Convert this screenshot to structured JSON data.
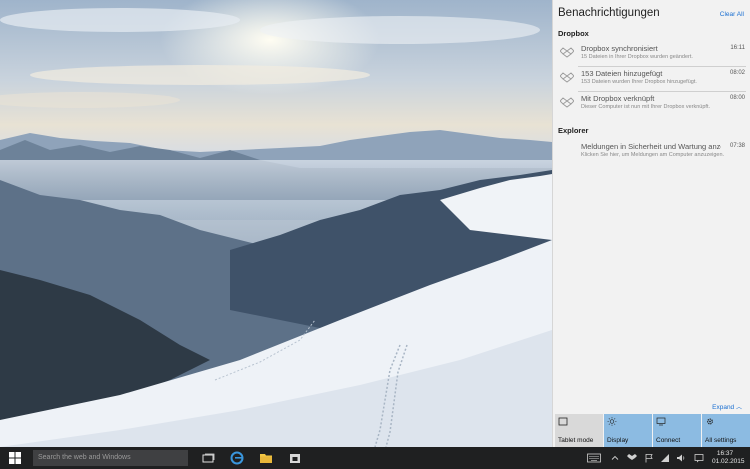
{
  "action_center": {
    "title": "Benachrichtigungen",
    "clear_all": "Clear All",
    "expand": "Expand",
    "groups": [
      {
        "name": "Dropbox",
        "notifications": [
          {
            "title": "Dropbox synchronisiert",
            "body": "15 Dateien in Ihrer Dropbox wurden geändert.",
            "time": "16:11"
          },
          {
            "title": "153 Dateien hinzugefügt",
            "body": "153 Dateien wurden Ihrer Dropbox hinzugefügt.",
            "time": "08:02"
          },
          {
            "title": "Mit Dropbox verknüpft",
            "body": "Dieser Computer ist nun mit Ihrer Dropbox verknüpft.",
            "time": "08:00"
          }
        ]
      },
      {
        "name": "Explorer",
        "notifications": [
          {
            "title": "Meldungen in Sicherheit und Wartung anzeigen",
            "body": "Klicken Sie hier, um Meldungen am Computer anzuzeigen.",
            "time": "07:38"
          }
        ]
      }
    ],
    "quick_actions": [
      {
        "label": "Tablet mode",
        "icon": "tablet-icon",
        "state": "off"
      },
      {
        "label": "Display",
        "icon": "brightness-icon",
        "state": "on"
      },
      {
        "label": "Connect",
        "icon": "connect-icon",
        "state": "on"
      },
      {
        "label": "All settings",
        "icon": "gear-icon",
        "state": "on"
      }
    ]
  },
  "taskbar": {
    "search_placeholder": "Search the web and Windows",
    "clock_time": "16:37",
    "clock_date": "01.02.2015",
    "pinned": [
      {
        "icon": "task-view-icon"
      },
      {
        "icon": "edge-browser-icon"
      },
      {
        "icon": "file-explorer-icon"
      },
      {
        "icon": "store-icon"
      }
    ],
    "tray": [
      {
        "icon": "keyboard-icon"
      },
      {
        "icon": "chevron-up-icon"
      },
      {
        "icon": "dropbox-tray-icon"
      },
      {
        "icon": "flag-icon"
      },
      {
        "icon": "monitor-icon"
      },
      {
        "icon": "signal-icon"
      },
      {
        "icon": "volume-icon"
      },
      {
        "icon": "input-icon"
      },
      {
        "icon": "notifications-icon"
      }
    ]
  },
  "colors": {
    "accent": "#1a6fd1",
    "quick_action_on": "#8cbbe2",
    "quick_action_off": "#d9d9d9",
    "taskbar": "#1f2021",
    "action_center_bg": "#f2f2f2"
  }
}
